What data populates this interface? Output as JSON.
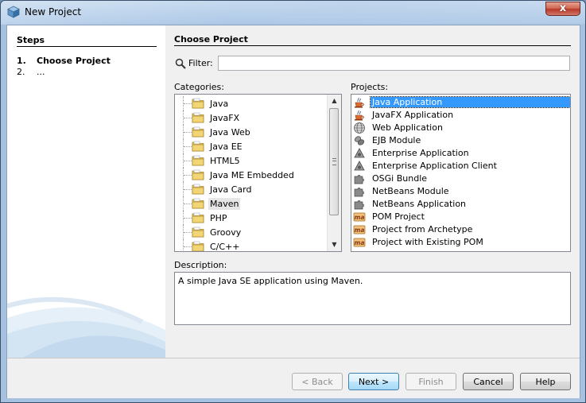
{
  "window": {
    "title": "New Project",
    "close_label": "x"
  },
  "steps": {
    "title": "Steps",
    "items": [
      {
        "num": "1.",
        "label": "Choose Project"
      },
      {
        "num": "2.",
        "label": "..."
      }
    ]
  },
  "main": {
    "title": "Choose Project",
    "filter_label": "Filter:",
    "filter_value": "",
    "categories_label": "Categories:",
    "projects_label": "Projects:",
    "categories": [
      {
        "label": "Java"
      },
      {
        "label": "JavaFX"
      },
      {
        "label": "Java Web"
      },
      {
        "label": "Java EE"
      },
      {
        "label": "HTML5"
      },
      {
        "label": "Java ME Embedded"
      },
      {
        "label": "Java Card"
      },
      {
        "label": "Maven"
      },
      {
        "label": "PHP"
      },
      {
        "label": "Groovy"
      },
      {
        "label": "C/C++"
      }
    ],
    "selected_category": "Maven",
    "projects": [
      {
        "label": "Java Application",
        "icon": "java-cup-icon"
      },
      {
        "label": "JavaFX Application",
        "icon": "java-cup-icon"
      },
      {
        "label": "Web Application",
        "icon": "globe-icon"
      },
      {
        "label": "EJB Module",
        "icon": "bean-icon"
      },
      {
        "label": "Enterprise Application",
        "icon": "triangle-icon"
      },
      {
        "label": "Enterprise Application Client",
        "icon": "triangle-icon"
      },
      {
        "label": "OSGi Bundle",
        "icon": "puzzle-icon"
      },
      {
        "label": "NetBeans Module",
        "icon": "puzzle-icon"
      },
      {
        "label": "NetBeans Application",
        "icon": "puzzle-icon"
      },
      {
        "label": "POM Project",
        "icon": "maven-icon"
      },
      {
        "label": "Project from Archetype",
        "icon": "maven-icon"
      },
      {
        "label": "Project with Existing POM",
        "icon": "maven-icon"
      }
    ],
    "selected_project": "Java Application",
    "description_label": "Description:",
    "description": "A simple Java SE application using Maven."
  },
  "buttons": {
    "back": "< Back",
    "next": "Next >",
    "finish": "Finish",
    "cancel": "Cancel",
    "help": "Help"
  },
  "colors": {
    "selection": "#3399ff",
    "folder": "#e8c55a"
  }
}
